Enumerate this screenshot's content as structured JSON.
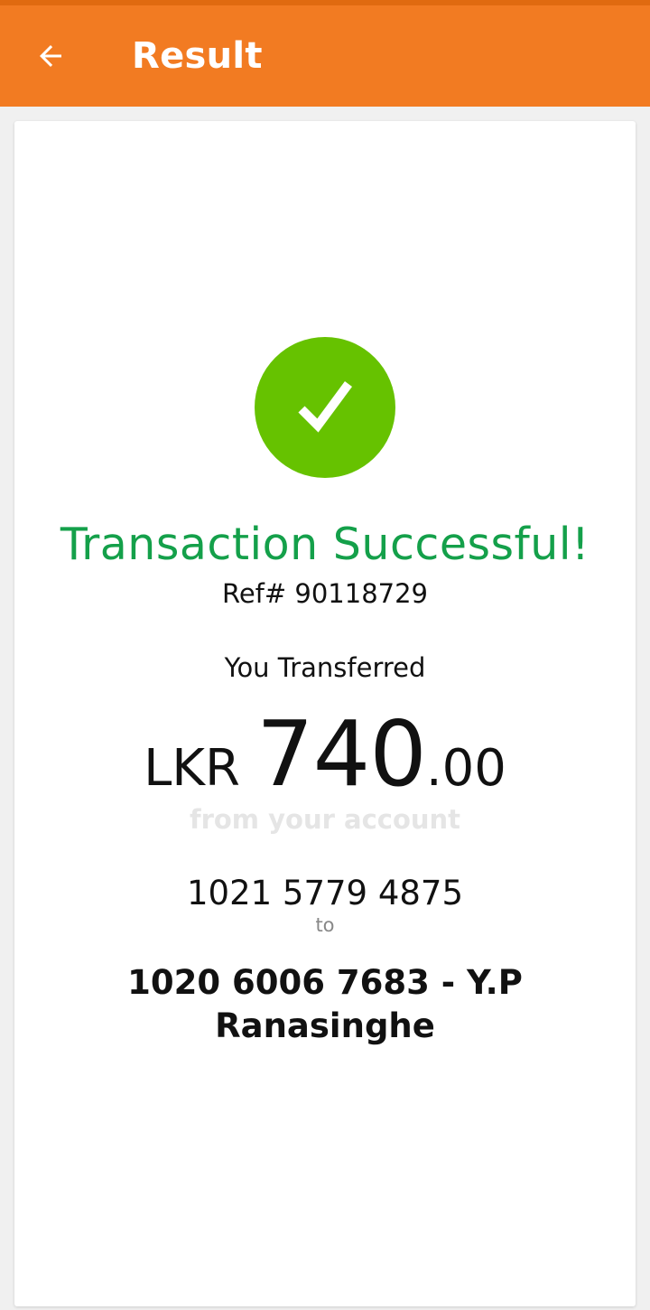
{
  "app_bar": {
    "title": "Result",
    "back_icon": "arrow-left-icon",
    "background_color": "#f27b22"
  },
  "result": {
    "status_icon": "check-circle-icon",
    "status_icon_color": "#66c200",
    "status_title": "Transaction Successful!",
    "status_color": "#14a04a",
    "reference": "Ref# 90118729",
    "transfer_label": "You Transferred",
    "amount": {
      "currency": "LKR",
      "major": "740",
      "minor": ".00"
    },
    "from_label": "from your account",
    "from_account": "1021 5779 4875",
    "to_label": "to",
    "to_account": "1020 6006 7683 - Y.P Ranasinghe"
  }
}
